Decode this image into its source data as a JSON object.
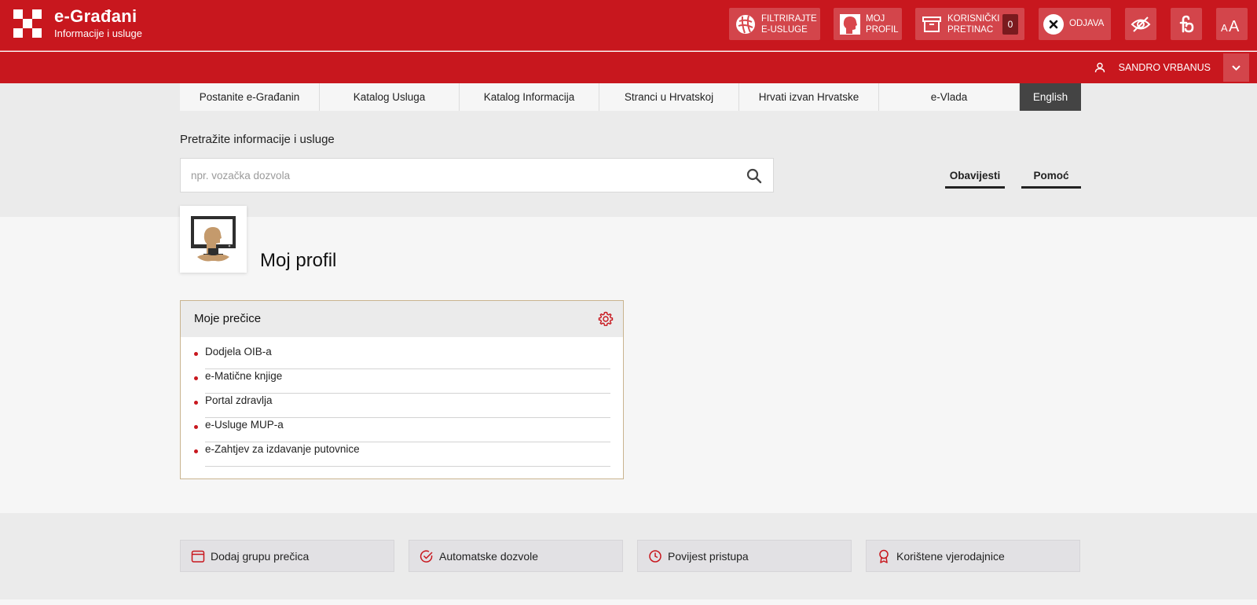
{
  "brand": {
    "title": "e-Građani",
    "subtitle": "Informacije i usluge"
  },
  "header_buttons": {
    "filter": "FILTRIRAJTE\nE-USLUGE",
    "profile": "MOJ\nPROFIL",
    "inbox": "KORISNIČKI\nPRETINAC",
    "inbox_count": "0",
    "logout": "ODJAVA",
    "accessibility_icon": "eye-off-icon",
    "dyslexia_icon": "dyslexic-font-icon",
    "font_size_icon": "text-size-icon"
  },
  "user": {
    "name": "SANDRO VRBANUS"
  },
  "nav": {
    "items": [
      {
        "label": "Postanite e-Građanin"
      },
      {
        "label": "Katalog Usluga"
      },
      {
        "label": "Katalog Informacija"
      },
      {
        "label": "Stranci u Hrvatskoj"
      },
      {
        "label": "Hrvati izvan Hrvatske"
      },
      {
        "label": "e-Vlada"
      },
      {
        "label": "English"
      }
    ]
  },
  "search": {
    "label": "Pretražite informacije i usluge",
    "placeholder": "npr. vozačka dozvola",
    "value": ""
  },
  "tabs": {
    "notices": "Obavijesti",
    "help": "Pomoć"
  },
  "page": {
    "title": "Moj profil"
  },
  "shortcuts": {
    "title": "Moje prečice",
    "items": [
      {
        "label": "Dodjela OIB-a"
      },
      {
        "label": "e-Matične knjige"
      },
      {
        "label": "Portal zdravlja"
      },
      {
        "label": "e-Usluge MUP-a"
      },
      {
        "label": "e-Zahtjev za izdavanje putovnice"
      }
    ]
  },
  "footer_buttons": {
    "add_group": "Dodaj grupu prečica",
    "auto_permissions": "Automatske dozvole",
    "access_history": "Povijest pristupa",
    "credentials": "Korištene vjerodajnice"
  },
  "colors": {
    "brand_red": "#c8171e",
    "dark_tab": "#444444",
    "panel_border": "#c9b48f"
  }
}
